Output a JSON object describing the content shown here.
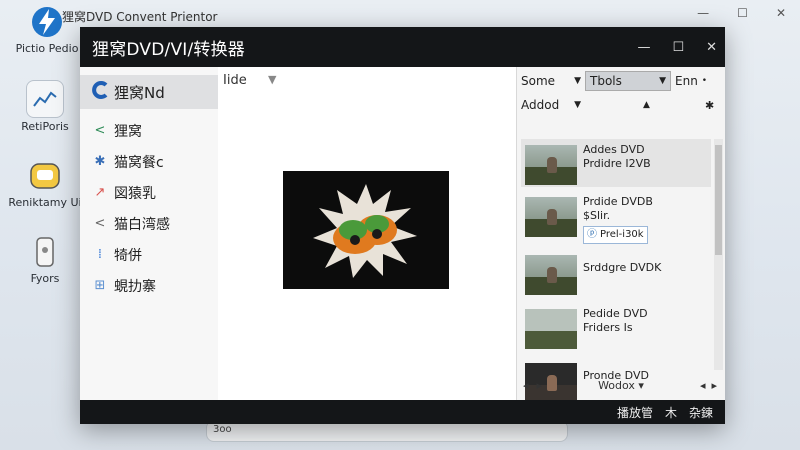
{
  "desktop": {
    "top_app_title": "狸窝DVD Convent Prientor",
    "icons": [
      {
        "label": "Pictio Pedio",
        "icon": "lightning-icon"
      },
      {
        "label": "RetiPoris",
        "icon": "chart-icon"
      },
      {
        "label": "Reniktamy Ui",
        "icon": "emoji-icon"
      },
      {
        "label": "Fyors",
        "icon": "phone-icon"
      }
    ],
    "window_controls": [
      "—",
      "☐",
      "✕"
    ],
    "taskbar_label": "3oo"
  },
  "window": {
    "title": "狸窝DVD/VI/转换器",
    "controls": {
      "min": "—",
      "max": "☐",
      "close": "✕"
    },
    "status_items": [
      "播放管",
      "木",
      "杂鍊"
    ]
  },
  "sidebar": {
    "items": [
      {
        "label": "狸窝Nd",
        "icon": "c-logo-icon",
        "active": true
      },
      {
        "label": "狸窝",
        "icon": "share-icon"
      },
      {
        "label": "猫窝餐c",
        "icon": "sparkle-icon"
      },
      {
        "label": "図猿乳",
        "icon": "arrow-icon"
      },
      {
        "label": "猫白湾感",
        "icon": "share-icon"
      },
      {
        "label": "犄併",
        "icon": "bars-icon"
      },
      {
        "label": "蜆扐寨",
        "icon": "grid-icon"
      }
    ]
  },
  "content": {
    "header": "Iide",
    "sort_icon": "caret-down-icon"
  },
  "panel": {
    "toolbar": {
      "some_label": "Some",
      "tools_label": "Tbols",
      "enn_label": "Enn",
      "added_label": "Addod"
    },
    "list": [
      {
        "lines": [
          "Addes DVD",
          "Prdidre I2VB"
        ],
        "selected": true
      },
      {
        "lines": [
          "Prdide DVDB",
          "$Slir."
        ],
        "badge": "Prel-i30k",
        "selected": false
      },
      {
        "lines": [
          "Srddgre DVDK"
        ],
        "selected": false
      },
      {
        "lines": [
          "Pedide DVD",
          "Friders Is"
        ],
        "selected": false
      },
      {
        "lines": [
          "Pronde DVD"
        ],
        "selected": false
      }
    ],
    "bottom": {
      "label": "Wodox ▾"
    }
  }
}
